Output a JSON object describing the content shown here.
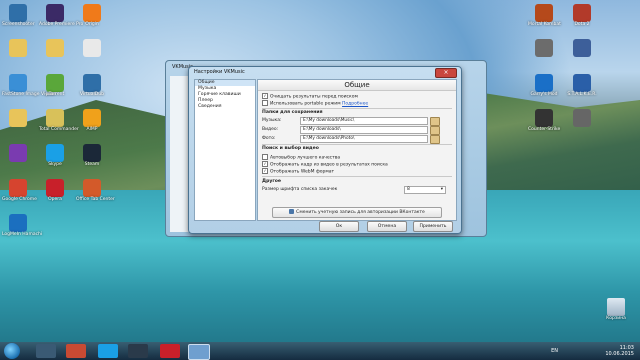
{
  "desktop_icons_left": [
    {
      "label": "Screenshooter",
      "color": "#2f6fa8"
    },
    {
      "label": "Adobe Premiere Pro",
      "color": "#3b2a66"
    },
    {
      "label": "Origin",
      "color": "#f07a1a"
    },
    {
      "label": "",
      "color": "#e8c45a"
    },
    {
      "label": "",
      "color": "#e8c45a"
    },
    {
      "label": "",
      "color": "#e9e9e9"
    },
    {
      "label": "FastStone Image Viewer",
      "color": "#3a8fd6"
    },
    {
      "label": "µTorrent",
      "color": "#5aa73a"
    },
    {
      "label": "VirtualDub",
      "color": "#2f6fa8"
    },
    {
      "label": "",
      "color": "#e8c45a"
    },
    {
      "label": "Total Commander",
      "color": "#d8c15a"
    },
    {
      "label": "AIMP",
      "color": "#f0a11b"
    },
    {
      "label": "",
      "color": "#7a3bb0"
    },
    {
      "label": "Skype",
      "color": "#1aa0e6"
    },
    {
      "label": "Steam",
      "color": "#1b2838"
    },
    {
      "label": "Google Chrome",
      "color": "#d6442f"
    },
    {
      "label": "Opera",
      "color": "#c8202a"
    },
    {
      "label": "Office Tab Center",
      "color": "#d35a2a"
    },
    {
      "label": "LogMeIn Hamachi",
      "color": "#1b6fbf"
    }
  ],
  "desktop_icons_right": [
    {
      "label": "Mortal Kombat",
      "color": "#b5491b"
    },
    {
      "label": "Dota 2",
      "color": "#b23a2a"
    },
    {
      "label": "",
      "color": "#6c6c6c"
    },
    {
      "label": "",
      "color": "#3d5f9a"
    },
    {
      "label": "Garry's Mod",
      "color": "#1a6fc7"
    },
    {
      "label": "S.T.A.L.K.E.R.",
      "color": "#2a5fa8"
    },
    {
      "label": "Counter-Strike",
      "color": "#333"
    },
    {
      "label": "",
      "color": "#666"
    }
  ],
  "back_window": {
    "title": "VKMusic"
  },
  "dialog": {
    "title": "Настройки VKMusic",
    "nav": [
      "Общие",
      "Музыка",
      "Горячие клавиши",
      "Плеер",
      "Сведения"
    ],
    "panel_title": "Общие",
    "opt_clear": "Очищать результаты перед поиском",
    "opt_portable": "Использовать portable режим",
    "opt_portable_link": "Подробнее",
    "sect_folders": "Папки для сохранения",
    "music_label": "Музыка:",
    "music_path": "E:\\My downloads\\Music\\",
    "video_label": "Видео:",
    "video_path": "E:\\My downloads\\",
    "photo_label": "Фото:",
    "photo_path": "E:\\My downloads\\Photo\\",
    "sect_search": "Поиск и выбор видео",
    "opt_autoq": "Автовыбор лучшего качества",
    "opt_frames": "Отображать кадр из видео в результатах поиска",
    "opt_webm": "Отображать WebM формат",
    "sect_other": "Другое",
    "font_label": "Размер шрифта списка закачек",
    "font_value": "8",
    "vk_button": "Сменить учетную запись для авторизации ВКонтакте",
    "ok": "Ок",
    "cancel": "Отмена",
    "apply": "Применить"
  },
  "taskbar": {
    "lang": "EN",
    "time": "11:03",
    "date": "10.06.2015"
  },
  "recycle_bin": "Корзина"
}
